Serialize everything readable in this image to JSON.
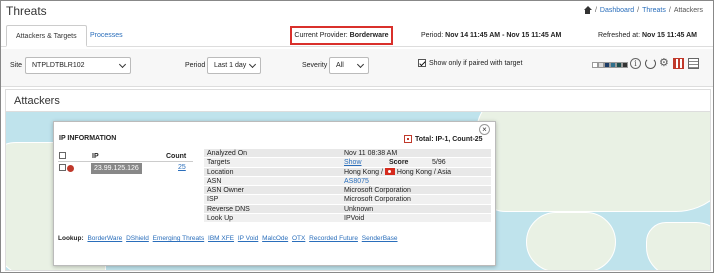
{
  "header": {
    "title": "Threats",
    "breadcrumb": [
      "Dashboard",
      "Threats",
      "Attackers"
    ]
  },
  "tabs": [
    {
      "label": "Attackers & Targets",
      "active": true
    },
    {
      "label": "Processes",
      "active": false
    }
  ],
  "provider": {
    "label": "Current Provider:",
    "value": "Borderware"
  },
  "period": {
    "label": "Period:",
    "value": "Nov 14 11:45 AM - Nov 15 11:45 AM"
  },
  "refreshed": {
    "label": "Refreshed at:",
    "value": "Nov 15 11:45 AM"
  },
  "filters": {
    "site_label": "Site",
    "site_value": "NTPLDTBLR102",
    "period_label": "Period",
    "period_value": "Last 1 day",
    "severity_label": "Severity",
    "severity_value": "All",
    "paired_label": "Show only if paired with target",
    "paired_checked": true
  },
  "severity_swatches": [
    "#ffffff",
    "#dddddd",
    "#1a3b66",
    "#2e6f8c",
    "#1f4f4f",
    "#333333"
  ],
  "icons": [
    "info-icon",
    "refresh-icon",
    "gear-icon",
    "qr-icon",
    "grid-icon"
  ],
  "section": {
    "title": "Attackers"
  },
  "popup": {
    "title": "IP INFORMATION",
    "total_label": "Total:",
    "total_value": "IP-1, Count-25",
    "ip_header": "IP",
    "count_header": "Count",
    "rows": [
      {
        "ip": "23.99.125.126",
        "count": "25"
      }
    ],
    "details": {
      "analyzed_on_key": "Analyzed On",
      "analyzed_on_val": "Nov 11 08:38 AM",
      "targets_key": "Targets",
      "targets_val": "Show",
      "score_label": "Score",
      "score_val": "5/96",
      "location_key": "Location",
      "location_val_1": "Hong Kong /",
      "location_val_2": "Hong Kong / Asia",
      "asn_key": "ASN",
      "asn_val": "AS8075",
      "asn_owner_key": "ASN Owner",
      "asn_owner_val": "Microsoft Corporation",
      "isp_key": "ISP",
      "isp_val": "Microsoft Corporation",
      "rdns_key": "Reverse DNS",
      "rdns_val": "Unknown",
      "lookup_key": "Look Up",
      "lookup_val": "IPVoid"
    },
    "lookup_label": "Lookup:",
    "lookup_links": [
      "BorderWare",
      "DShield",
      "Emerging Threats",
      "IBM XFE",
      "IP Void",
      "MalcOde",
      "OTX",
      "Recorded Future",
      "SenderBase"
    ]
  }
}
